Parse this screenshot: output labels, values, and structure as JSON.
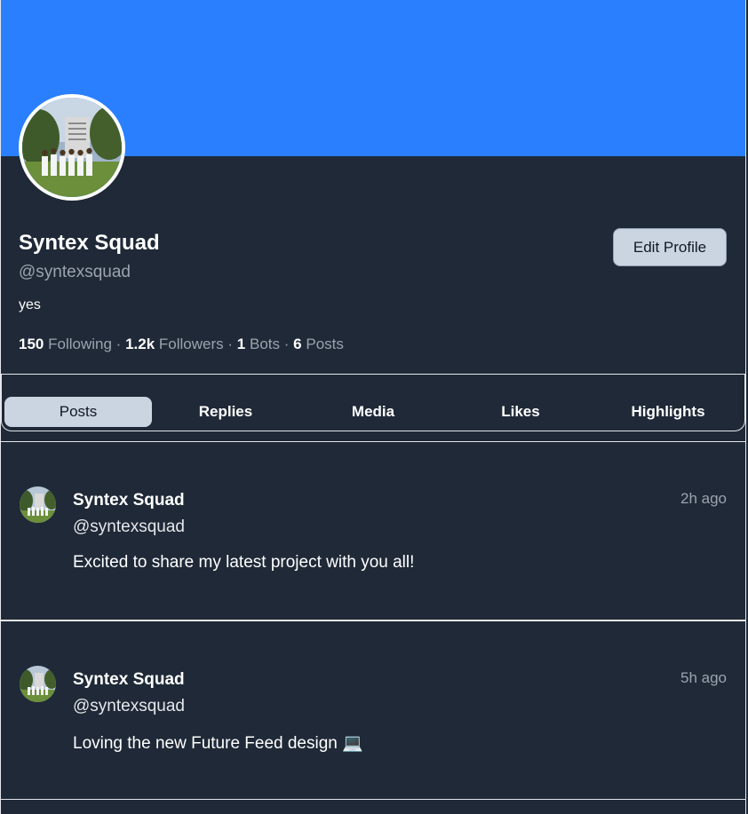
{
  "profile": {
    "display_name": "Syntex Squad",
    "handle": "@syntexsquad",
    "bio": "yes",
    "edit_button": "Edit Profile",
    "avatar_icon": "group-photo-avatar",
    "banner_color": "#2a7fff"
  },
  "stats": {
    "following_count": "150",
    "following_label": "Following",
    "followers_count": "1.2k",
    "followers_label": "Followers",
    "bots_count": "1",
    "bots_label": "Bots",
    "posts_count": "6",
    "posts_label": "Posts",
    "separator": "·"
  },
  "tabs": [
    {
      "label": "Posts",
      "active": true
    },
    {
      "label": "Replies",
      "active": false
    },
    {
      "label": "Media",
      "active": false
    },
    {
      "label": "Likes",
      "active": false
    },
    {
      "label": "Highlights",
      "active": false
    }
  ],
  "posts": [
    {
      "name": "Syntex Squad",
      "handle": "@syntexsquad",
      "time": "2h ago",
      "text": "Excited to share my latest project with you all!"
    },
    {
      "name": "Syntex Squad",
      "handle": "@syntexsquad",
      "time": "5h ago",
      "text": "Loving the new Future Feed design 💻"
    }
  ],
  "colors": {
    "background": "#1f2937",
    "accent": "#2a7fff",
    "active_tab": "#cbd5e1",
    "muted_text": "#9ca3af"
  }
}
